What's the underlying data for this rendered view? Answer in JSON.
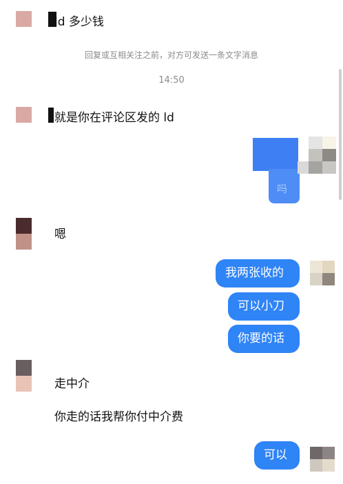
{
  "chat": {
    "messages": {
      "m1": "ld 多少钱",
      "notice": "回复或互相关注之前，对方可发送一条文字消息",
      "time": "14:50",
      "m2": "就是你在评论区发的 ld",
      "m3_mosaic": "吗",
      "m4": "嗯",
      "r1": "我两张收的",
      "r2": "可以小刀",
      "r3": "你要的话",
      "m5": "走中介",
      "m6": "你走的话我帮你付中介费",
      "r4": "可以"
    }
  },
  "colors": {
    "bubble_blue": "#2f84f6",
    "background": "#ffffff"
  }
}
